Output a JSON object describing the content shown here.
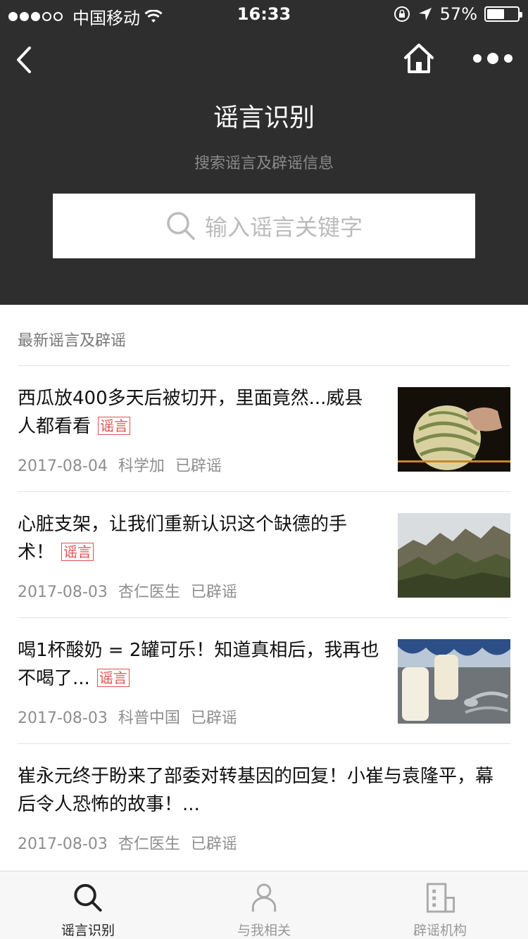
{
  "status_bar": {
    "carrier": "中国移动",
    "time": "16:33",
    "battery_percent": "57%",
    "battery_level": 0.57,
    "signal_bars": 3
  },
  "header": {
    "title": "谣言识别",
    "subtitle": "搜索谣言及辟谣信息",
    "back_icon": "chevron-left-icon",
    "home_icon": "home-icon",
    "more_icon": "more-dots-icon"
  },
  "search": {
    "placeholder": "输入谣言关键字",
    "icon": "search-icon"
  },
  "section": {
    "title": "最新谣言及辟谣"
  },
  "news": [
    {
      "title": "西瓜放400多天后被切开，里面竟然...威县人都看看",
      "tag": "谣言",
      "date": "2017-08-04",
      "source": "科学加",
      "status": "已辟谣",
      "thumb": "watermelon-image"
    },
    {
      "title": "心脏支架，让我们重新认识这个缺德的手术！",
      "tag": "谣言",
      "date": "2017-08-03",
      "source": "杏仁医生",
      "status": "已辟谣",
      "thumb": "mountain-image"
    },
    {
      "title": "喝1杯酸奶 = 2罐可乐！知道真相后，我再也不喝了...",
      "tag": "谣言",
      "date": "2017-08-03",
      "source": "科普中国",
      "status": "已辟谣",
      "thumb": "yogurt-image"
    },
    {
      "title": "崔永元终于盼来了部委对转基因的回复！小崔与袁隆平，幕后令人恐怖的故事！...",
      "tag": "",
      "date": "2017-08-03",
      "source": "杏仁医生",
      "status": "已辟谣",
      "thumb": ""
    }
  ],
  "tabs": [
    {
      "label": "谣言识别",
      "icon": "search-icon",
      "active": true
    },
    {
      "label": "与我相关",
      "icon": "person-icon",
      "active": false
    },
    {
      "label": "辟谣机构",
      "icon": "building-icon",
      "active": false
    }
  ],
  "colors": {
    "header_bg": "#2e2e2e",
    "tag": "#e0514f",
    "meta": "#8e8e8e"
  }
}
